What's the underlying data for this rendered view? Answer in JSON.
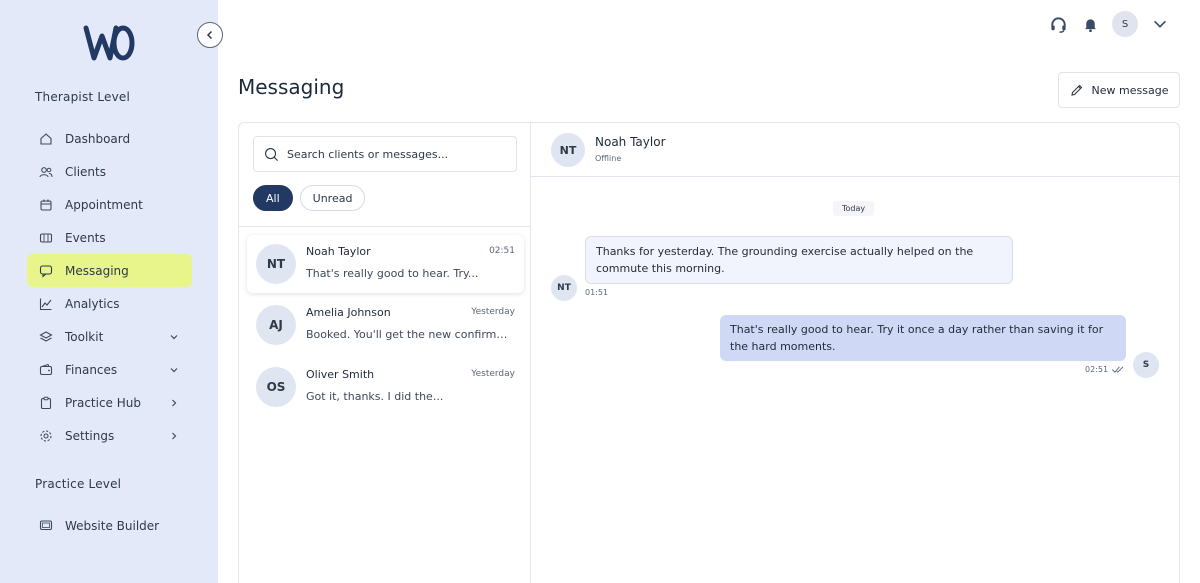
{
  "sidebar": {
    "section_therapist": "Therapist Level",
    "items": [
      {
        "label": "Dashboard",
        "icon": "home-icon"
      },
      {
        "label": "Clients",
        "icon": "users-icon"
      },
      {
        "label": "Appointment",
        "icon": "calendar-icon"
      },
      {
        "label": "Events",
        "icon": "ticket-icon"
      },
      {
        "label": "Messaging",
        "icon": "chat-icon",
        "active": true
      },
      {
        "label": "Analytics",
        "icon": "chart-icon"
      },
      {
        "label": "Toolkit",
        "icon": "layers-icon",
        "chevron": "down"
      },
      {
        "label": "Finances",
        "icon": "wallet-icon",
        "chevron": "down"
      },
      {
        "label": "Practice Hub",
        "icon": "clipboard-icon",
        "chevron": "right"
      },
      {
        "label": "Settings",
        "icon": "gear-icon",
        "chevron": "right"
      }
    ],
    "section_practice": "Practice Level",
    "practice_items": [
      {
        "label": "Website Builder",
        "icon": "monitor-icon"
      }
    ]
  },
  "topbar": {
    "avatar_initial": "S"
  },
  "page": {
    "title": "Messaging",
    "new_message_label": "New message"
  },
  "list": {
    "search_placeholder": "Search clients or messages...",
    "filters": [
      "All",
      "Unread"
    ],
    "conversations": [
      {
        "initials": "NT",
        "name": "Noah Taylor",
        "time": "02:51",
        "preview": "That's really good to hear. Try..."
      },
      {
        "initials": "AJ",
        "name": "Amelia Johnson",
        "time": "Yesterday",
        "preview": "Booked. You'll get the new confirmation email shortly."
      },
      {
        "initials": "OS",
        "name": "Oliver Smith",
        "time": "Yesterday",
        "preview": "Got it, thanks. I did the..."
      }
    ]
  },
  "chat": {
    "initials": "NT",
    "name": "Noah Taylor",
    "status": "Offline",
    "day_label": "Today",
    "messages": [
      {
        "direction": "in",
        "avatar": "NT",
        "text": "Thanks for yesterday. The grounding exercise actually helped on the commute this morning.",
        "time": "01:51"
      },
      {
        "direction": "out",
        "avatar": "S",
        "text": "That's really good to hear. Try it once a day rather than saving it for the hard moments.",
        "time": "02:51"
      }
    ]
  },
  "colors": {
    "sidebar_bg": "#e3e9f8",
    "active_nav": "#e7f58a",
    "chip_active": "#223a63",
    "bubble_out": "#cfd9f5",
    "bubble_in": "#f1f4fd"
  }
}
